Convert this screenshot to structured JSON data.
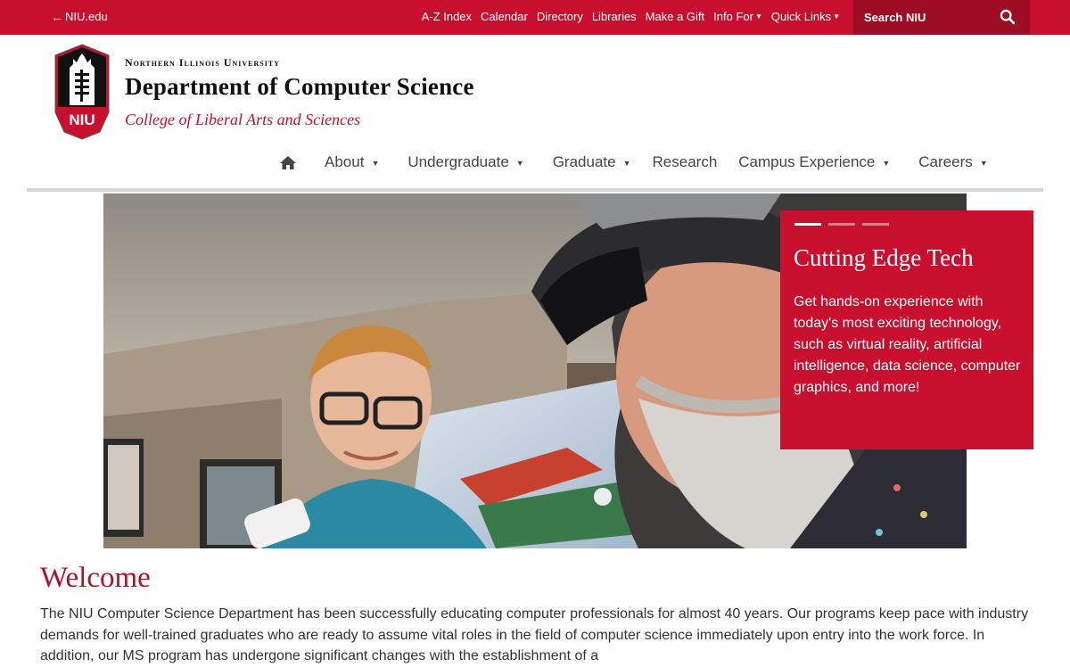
{
  "topbar": {
    "back_link": "NIU.edu",
    "utility_links": [
      {
        "label": "A-Z Index",
        "caret": false
      },
      {
        "label": "Calendar",
        "caret": false
      },
      {
        "label": "Directory",
        "caret": false
      },
      {
        "label": "Libraries",
        "caret": false
      },
      {
        "label": "Make a Gift",
        "caret": false
      },
      {
        "label": "Info For",
        "caret": true
      },
      {
        "label": "Quick Links",
        "caret": true
      }
    ],
    "search_placeholder": "Search NIU",
    "colors": {
      "bar": "#c8102e",
      "search": "#9c0c23"
    }
  },
  "header": {
    "logo_text": "NIU",
    "university": "Northern Illinois University",
    "department": "Department of Computer Science",
    "college": "College of Liberal Arts and Sciences"
  },
  "main_nav": {
    "home_icon": "home-icon",
    "items": [
      {
        "label": "About",
        "caret": true
      },
      {
        "label": "Undergraduate",
        "caret": true
      },
      {
        "label": "Graduate",
        "caret": true
      },
      {
        "label": "Research",
        "caret": false
      },
      {
        "label": "Campus Experience",
        "caret": true
      },
      {
        "label": "Careers",
        "caret": true
      }
    ]
  },
  "hero": {
    "slide_count": 3,
    "active_slide": 1,
    "caption_title": "Cutting Edge Tech",
    "caption_text": "Get hands-on experience with today's most exciting technology, such as virtual reality, artificial intelligence, data science, computer graphics, and more!",
    "accent": "#c8102e"
  },
  "welcome": {
    "title": "Welcome",
    "body": "The NIU Computer Science Department has been successfully educating computer professionals for almost 40 years. Our programs keep pace with industry demands for well-trained graduates who are ready to assume vital roles in the field of computer science immediately upon entry into the work force. In addition, our MS program has undergone significant changes with the establishment of a"
  }
}
